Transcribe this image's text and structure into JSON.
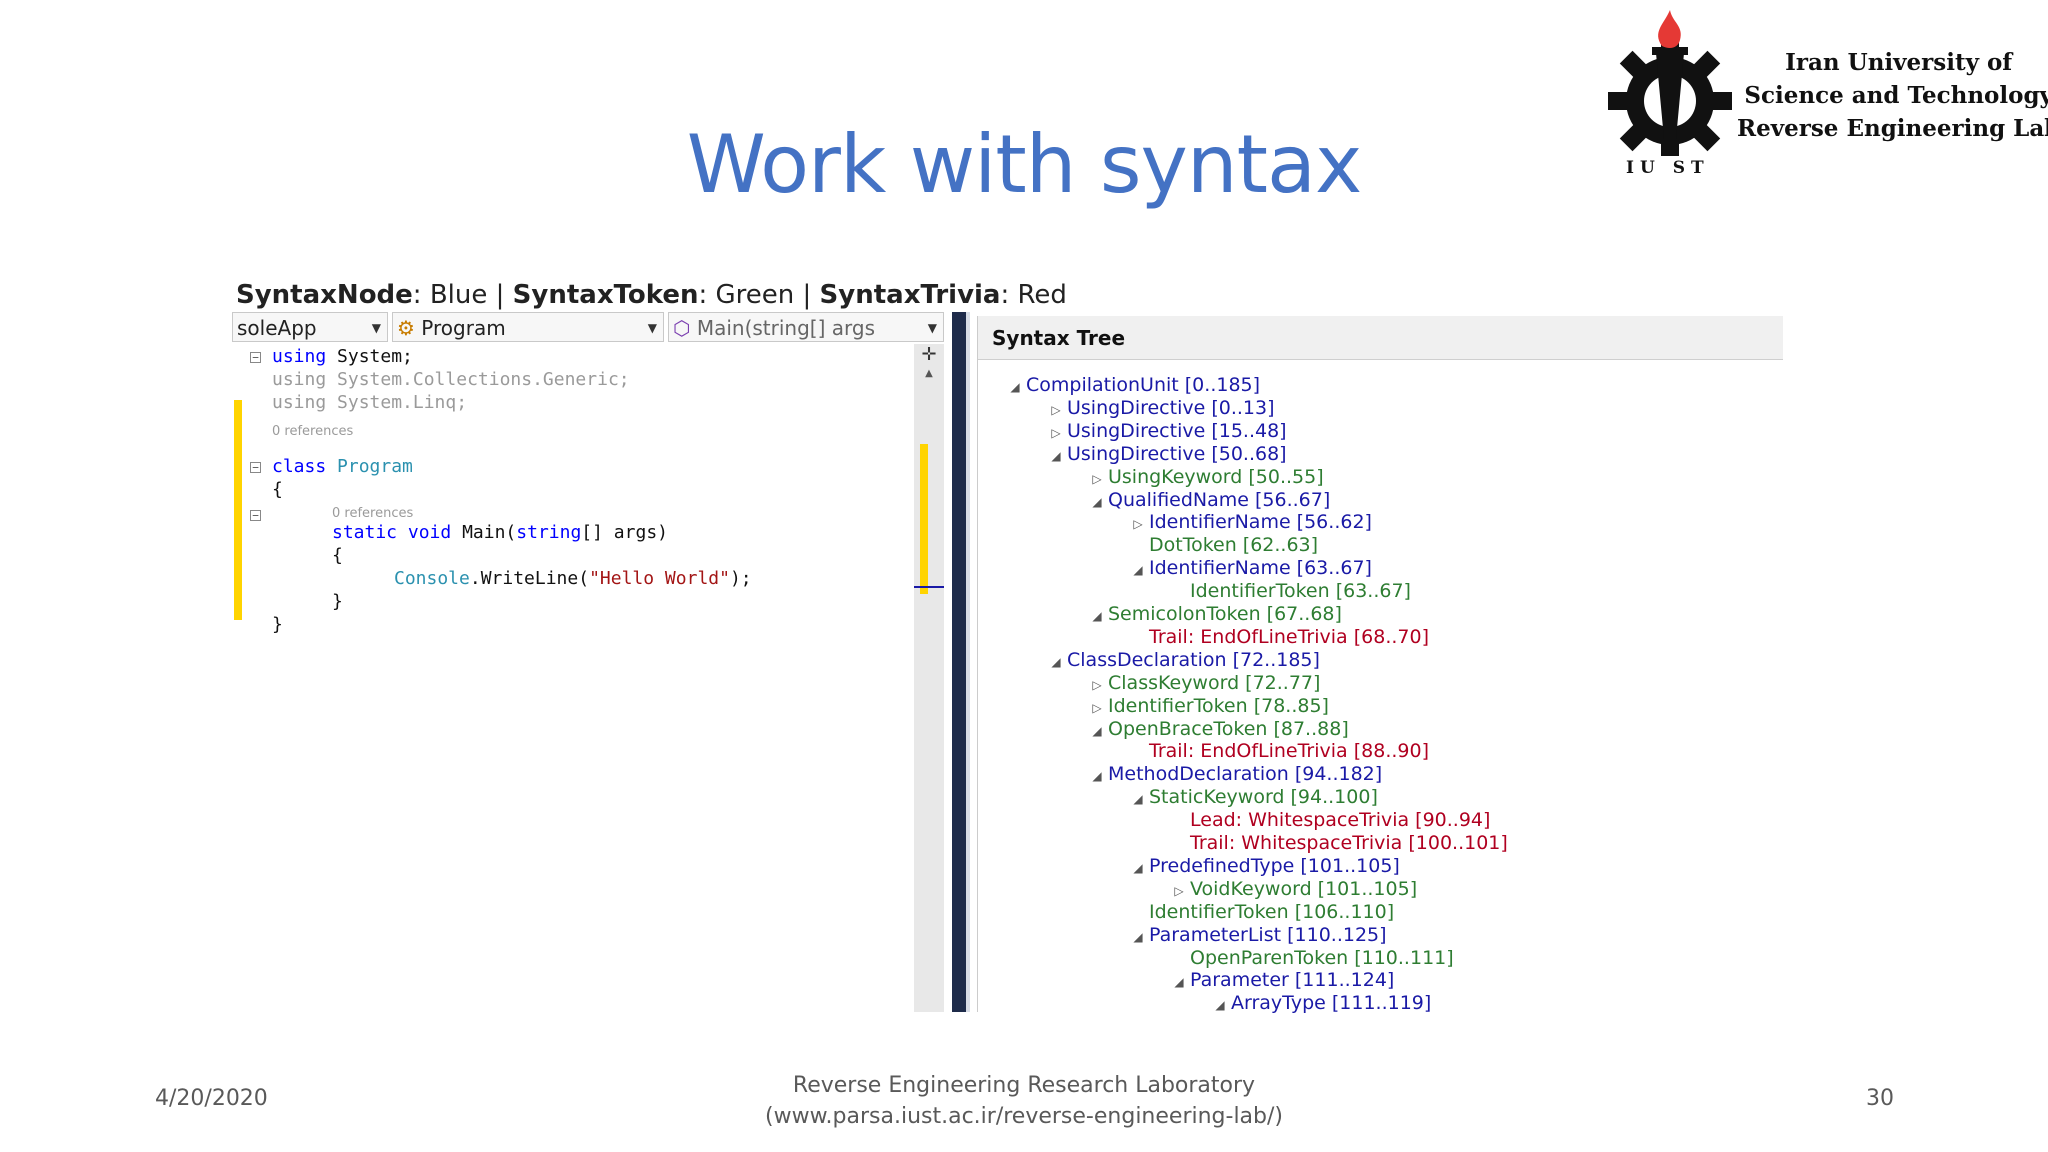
{
  "slide": {
    "title": "Work with syntax",
    "footer_date": "4/20/2020",
    "footer_lab": "Reverse Engineering Research Laboratory",
    "footer_url": "(www.parsa.iust.ac.ir/reverse-engineering-lab/)",
    "page_number": "30"
  },
  "logo": {
    "line1": "Iran University of",
    "line2": "Science and Technology",
    "line3": "Reverse Engineering Lab",
    "acronym": "IU  ST"
  },
  "legend": {
    "node_label": "SyntaxNode",
    "node_color": ": Blue | ",
    "token_label": "SyntaxToken",
    "token_color": ": Green | ",
    "trivia_label": "SyntaxTrivia",
    "trivia_color": ": Red"
  },
  "editor": {
    "combo_project": "soleApp",
    "combo_class": "Program",
    "combo_member": "Main(string[] args",
    "code_using1_kw": "using",
    "code_using1": " System;",
    "code_using2": "using System.Collections.Generic;",
    "code_using3": "using System.Linq;",
    "refs1": "0 references",
    "code_class_kw": "class",
    "code_class_name": "Program",
    "brace_open": "{",
    "refs2": "0 references",
    "code_static": "static",
    "code_void": "void",
    "code_main": " Main(",
    "code_string": "string",
    "code_args": "[] args)",
    "brace_open2": "{",
    "code_console": "Console",
    "code_writeline": ".WriteLine(",
    "code_literal": "\"Hello World\"",
    "code_end": ");",
    "brace_close2": "}",
    "brace_close": "}"
  },
  "tree": {
    "header": "Syntax Tree",
    "nodes": [
      {
        "text": "CompilationUnit [0..185]",
        "kind": "node",
        "toggle": "expanded",
        "level": 0
      },
      {
        "text": "UsingDirective [0..13]",
        "kind": "node",
        "toggle": "collapsed",
        "level": 1
      },
      {
        "text": "UsingDirective [15..48]",
        "kind": "node",
        "toggle": "collapsed",
        "level": 1
      },
      {
        "text": "UsingDirective [50..68]",
        "kind": "node",
        "toggle": "expanded",
        "level": 1
      },
      {
        "text": "UsingKeyword [50..55]",
        "kind": "token",
        "toggle": "collapsed",
        "level": 2
      },
      {
        "text": "QualifiedName [56..67]",
        "kind": "node",
        "toggle": "expanded",
        "level": 2
      },
      {
        "text": "IdentifierName [56..62]",
        "kind": "node",
        "toggle": "collapsed",
        "level": 3
      },
      {
        "text": "DotToken [62..63]",
        "kind": "token",
        "toggle": "none",
        "level": 3
      },
      {
        "text": "IdentifierName [63..67]",
        "kind": "node",
        "toggle": "expanded",
        "level": 3
      },
      {
        "text": "IdentifierToken [63..67]",
        "kind": "token",
        "toggle": "none",
        "level": 4
      },
      {
        "text": "SemicolonToken [67..68]",
        "kind": "token",
        "toggle": "expanded",
        "level": 2
      },
      {
        "text": "Trail: EndOfLineTrivia [68..70]",
        "kind": "trivia",
        "toggle": "none",
        "level": 3
      },
      {
        "text": "ClassDeclaration [72..185]",
        "kind": "node",
        "toggle": "expanded",
        "level": 1
      },
      {
        "text": "ClassKeyword [72..77]",
        "kind": "token",
        "toggle": "collapsed",
        "level": 2
      },
      {
        "text": "IdentifierToken [78..85]",
        "kind": "token",
        "toggle": "collapsed",
        "level": 2
      },
      {
        "text": "OpenBraceToken [87..88]",
        "kind": "token",
        "toggle": "expanded",
        "level": 2
      },
      {
        "text": "Trail: EndOfLineTrivia [88..90]",
        "kind": "trivia",
        "toggle": "none",
        "level": 3
      },
      {
        "text": "MethodDeclaration [94..182]",
        "kind": "node",
        "toggle": "expanded",
        "level": 2
      },
      {
        "text": "StaticKeyword [94..100]",
        "kind": "token",
        "toggle": "expanded",
        "level": 3
      },
      {
        "text": "Lead: WhitespaceTrivia [90..94]",
        "kind": "trivia",
        "toggle": "none",
        "level": 4
      },
      {
        "text": "Trail: WhitespaceTrivia [100..101]",
        "kind": "trivia",
        "toggle": "none",
        "level": 4
      },
      {
        "text": "PredefinedType [101..105]",
        "kind": "node",
        "toggle": "expanded",
        "level": 3
      },
      {
        "text": "VoidKeyword [101..105]",
        "kind": "token",
        "toggle": "collapsed",
        "level": 4
      },
      {
        "text": "IdentifierToken [106..110]",
        "kind": "token",
        "toggle": "none",
        "level": 3
      },
      {
        "text": "ParameterList [110..125]",
        "kind": "node",
        "toggle": "expanded",
        "level": 3
      },
      {
        "text": "OpenParenToken [110..111]",
        "kind": "token",
        "toggle": "none",
        "level": 4
      },
      {
        "text": "Parameter [111..124]",
        "kind": "node",
        "toggle": "expanded",
        "level": 4
      },
      {
        "text": "ArrayType [111..119]",
        "kind": "node",
        "toggle": "expanded",
        "level": 5
      }
    ]
  },
  "colors": {
    "title": "#4472c4",
    "node": "#1a1aa6",
    "token": "#2e7d32",
    "trivia": "#b00020"
  }
}
